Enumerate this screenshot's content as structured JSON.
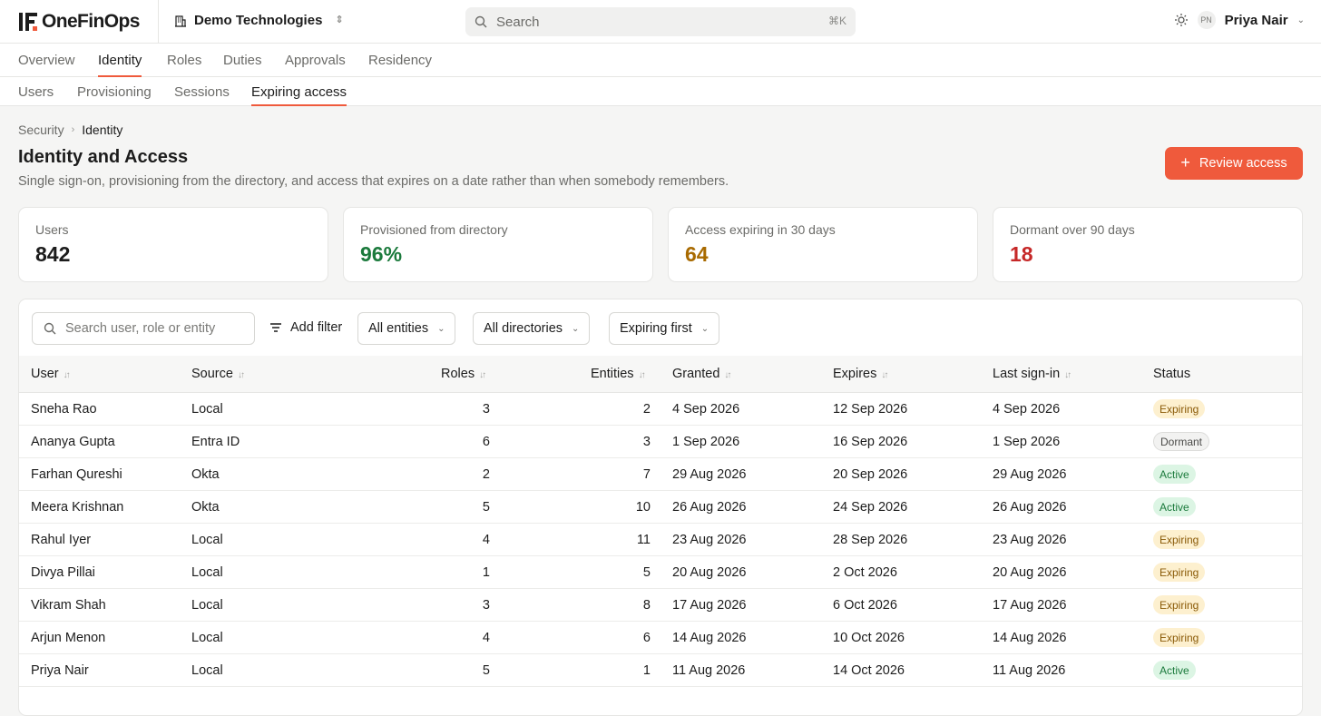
{
  "app": {
    "name": "OneFinOps"
  },
  "org": {
    "name": "Demo Technologies"
  },
  "search": {
    "placeholder": "Search",
    "shortcut": "⌘K"
  },
  "user": {
    "initials": "PN",
    "name": "Priya Nair"
  },
  "tabs": [
    "Overview",
    "Identity",
    "Roles",
    "Duties",
    "Approvals",
    "Residency"
  ],
  "subtabs": [
    "Users",
    "Provisioning",
    "Sessions",
    "Expiring access"
  ],
  "breadcrumb": {
    "parent": "Security",
    "current": "Identity"
  },
  "page": {
    "title": "Identity and Access",
    "subtitle": "Single sign-on, provisioning from the directory, and access that expires on a date rather than when somebody remembers.",
    "cta": "Review access"
  },
  "stats": [
    {
      "label": "Users",
      "value": "842",
      "color": "#1c1c1c"
    },
    {
      "label": "Provisioned from directory",
      "value": "96%",
      "color": "#1b7a3c"
    },
    {
      "label": "Access expiring in 30 days",
      "value": "64",
      "color": "#a86a00"
    },
    {
      "label": "Dormant over 90 days",
      "value": "18",
      "color": "#c62828"
    }
  ],
  "toolbar": {
    "search_placeholder": "Search user, role or entity",
    "add_filter": "Add filter",
    "entities": "All entities",
    "directories": "All directories",
    "sort": "Expiring first"
  },
  "table": {
    "columns": [
      "User",
      "Source",
      "Roles",
      "Entities",
      "Granted",
      "Expires",
      "Last sign-in",
      "Status"
    ],
    "rows": [
      {
        "user": "Sneha Rao",
        "source": "Local",
        "roles": "3",
        "entities": "2",
        "granted": "4 Sep 2026",
        "expires": "12 Sep 2026",
        "last": "4 Sep 2026",
        "status": "Expiring"
      },
      {
        "user": "Ananya Gupta",
        "source": "Entra ID",
        "roles": "6",
        "entities": "3",
        "granted": "1 Sep 2026",
        "expires": "16 Sep 2026",
        "last": "1 Sep 2026",
        "status": "Dormant"
      },
      {
        "user": "Farhan Qureshi",
        "source": "Okta",
        "roles": "2",
        "entities": "7",
        "granted": "29 Aug 2026",
        "expires": "20 Sep 2026",
        "last": "29 Aug 2026",
        "status": "Active"
      },
      {
        "user": "Meera Krishnan",
        "source": "Okta",
        "roles": "5",
        "entities": "10",
        "granted": "26 Aug 2026",
        "expires": "24 Sep 2026",
        "last": "26 Aug 2026",
        "status": "Active"
      },
      {
        "user": "Rahul Iyer",
        "source": "Local",
        "roles": "4",
        "entities": "11",
        "granted": "23 Aug 2026",
        "expires": "28 Sep 2026",
        "last": "23 Aug 2026",
        "status": "Expiring"
      },
      {
        "user": "Divya Pillai",
        "source": "Local",
        "roles": "1",
        "entities": "5",
        "granted": "20 Aug 2026",
        "expires": "2 Oct 2026",
        "last": "20 Aug 2026",
        "status": "Expiring"
      },
      {
        "user": "Vikram Shah",
        "source": "Local",
        "roles": "3",
        "entities": "8",
        "granted": "17 Aug 2026",
        "expires": "6 Oct 2026",
        "last": "17 Aug 2026",
        "status": "Expiring"
      },
      {
        "user": "Arjun Menon",
        "source": "Local",
        "roles": "4",
        "entities": "6",
        "granted": "14 Aug 2026",
        "expires": "10 Oct 2026",
        "last": "14 Aug 2026",
        "status": "Expiring"
      },
      {
        "user": "Priya Nair",
        "source": "Local",
        "roles": "5",
        "entities": "1",
        "granted": "11 Aug 2026",
        "expires": "14 Oct 2026",
        "last": "11 Aug 2026",
        "status": "Active"
      }
    ]
  },
  "colors": {
    "accent": "#ef5a3c"
  }
}
